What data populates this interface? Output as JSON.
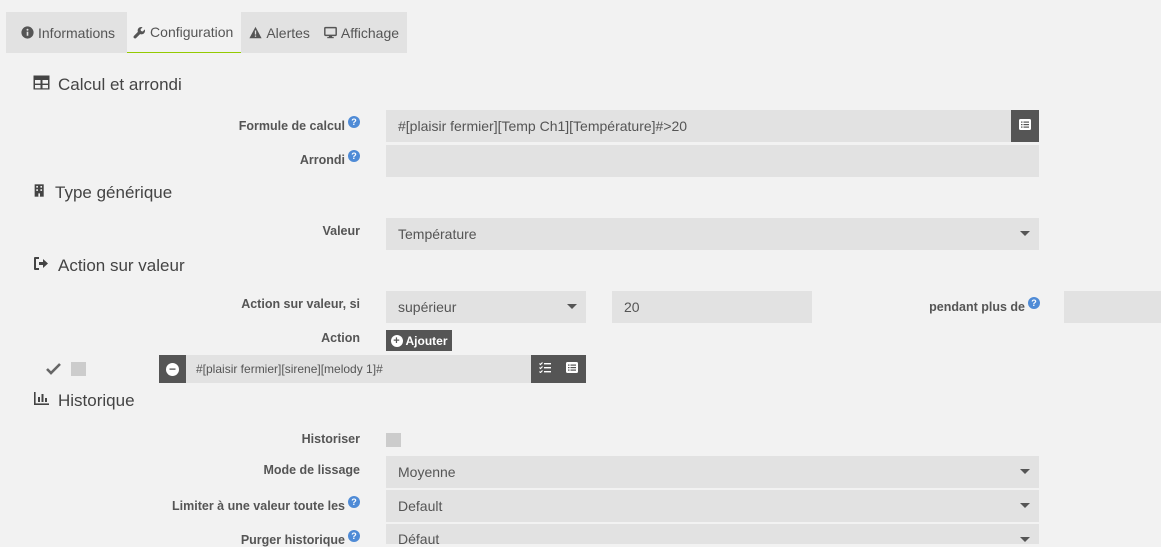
{
  "tabs": [
    {
      "label": "Informations",
      "icon": "info-circle-icon"
    },
    {
      "label": "Configuration",
      "icon": "wrench-icon"
    },
    {
      "label": "Alertes",
      "icon": "warning-icon"
    },
    {
      "label": "Affichage",
      "icon": "monitor-icon"
    }
  ],
  "sections": {
    "calcul": "Calcul et arrondi",
    "type": "Type générique",
    "action": "Action sur valeur",
    "historique": "Historique"
  },
  "calcul": {
    "formule_label": "Formule de calcul",
    "formule_value": "#[plaisir fermier][Temp Ch1][Température]#>20",
    "arrondi_label": "Arrondi",
    "arrondi_value": ""
  },
  "type": {
    "valeur_label": "Valeur",
    "valeur_value": "Température"
  },
  "action": {
    "si_label": "Action sur valeur, si",
    "operator": "supérieur",
    "threshold": "20",
    "pendant_label": "pendant plus de",
    "pendant_value": "",
    "action_label": "Action",
    "add_button": "Ajouter",
    "command": "#[plaisir fermier][sirene][melody 1]#"
  },
  "historique": {
    "historiser_label": "Historiser",
    "lissage_label": "Mode de lissage",
    "lissage_value": "Moyenne",
    "limiter_label": "Limiter à une valeur toute les",
    "limiter_value": "Default",
    "purger_label": "Purger historique",
    "purger_value": "Défaut"
  },
  "help_glyph": "?",
  "minus_glyph": "−",
  "plus_glyph": "+"
}
